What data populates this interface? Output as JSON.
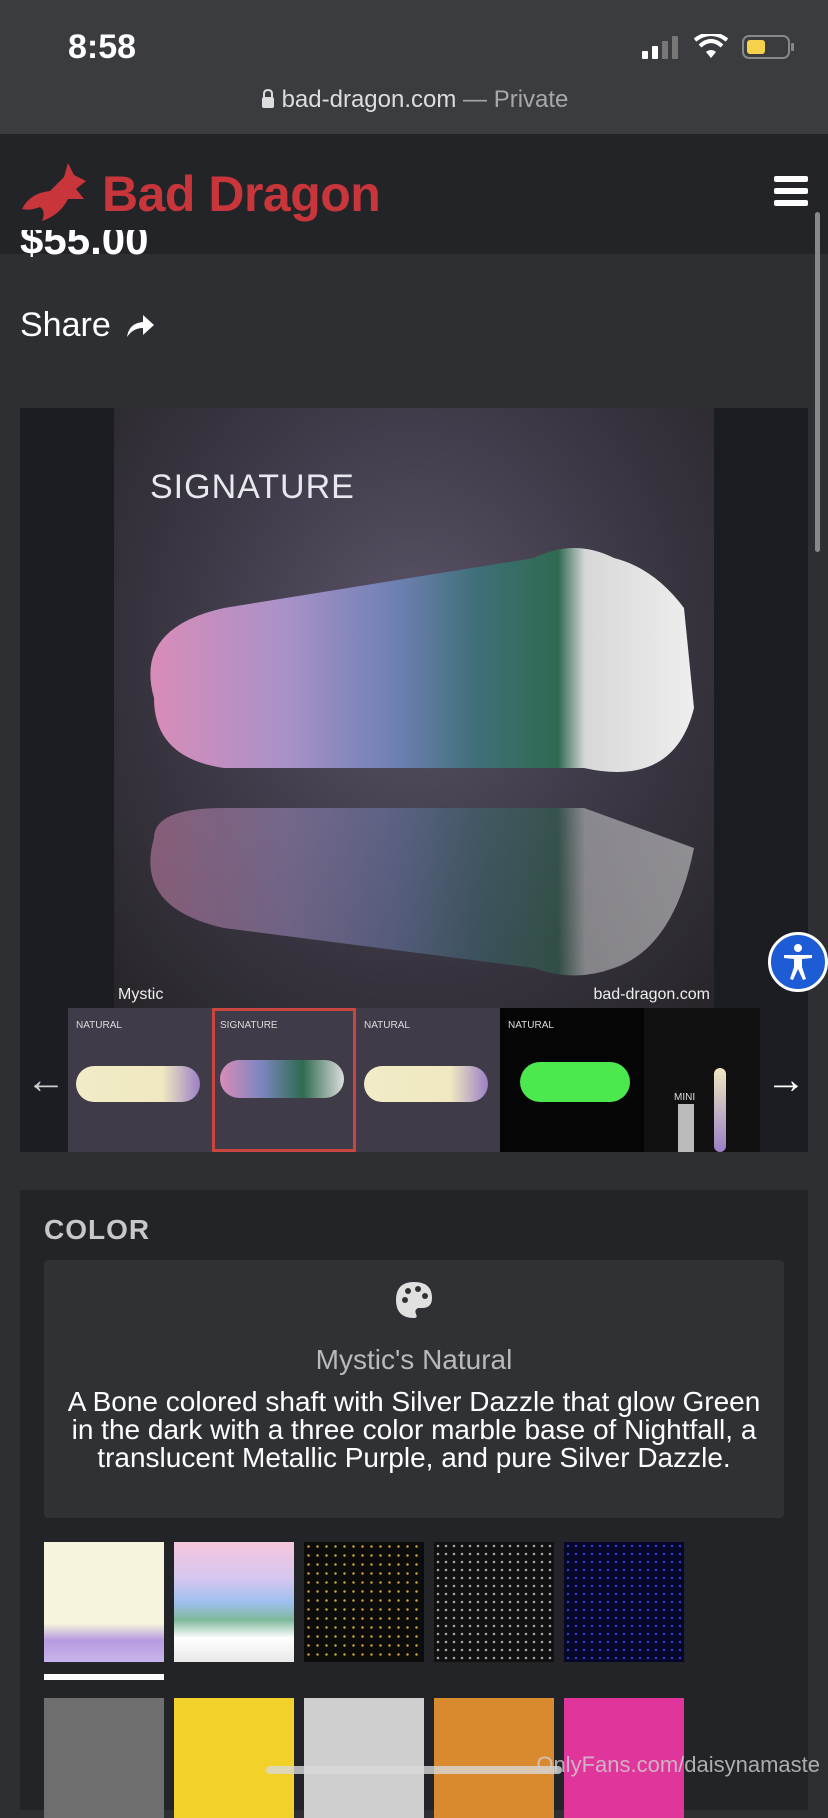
{
  "status_bar": {
    "time": "8:58"
  },
  "browser": {
    "domain": "bad-dragon.com",
    "separator": " — ",
    "mode": "Private"
  },
  "header": {
    "brand": "Bad Dragon"
  },
  "product": {
    "price": "$55.00",
    "share_label": "Share"
  },
  "gallery": {
    "main_tag": "SIGNATURE",
    "caption_left": "Mystic",
    "caption_right": "bad-dragon.com",
    "thumbnails": [
      {
        "tag": "NATURAL"
      },
      {
        "tag": "SIGNATURE"
      },
      {
        "tag": "NATURAL"
      },
      {
        "tag": "NATURAL"
      },
      {
        "tag": "MINI"
      }
    ]
  },
  "color": {
    "heading": "COLOR",
    "name": "Mystic's Natural",
    "description": "A Bone colored shaft with Silver Dazzle that glow Green in the dark with a three color marble base of Nightfall, a translucent Metallic Purple, and pure Silver Dazzle."
  },
  "watermark": "OnlyFans.com/daisynamaste"
}
